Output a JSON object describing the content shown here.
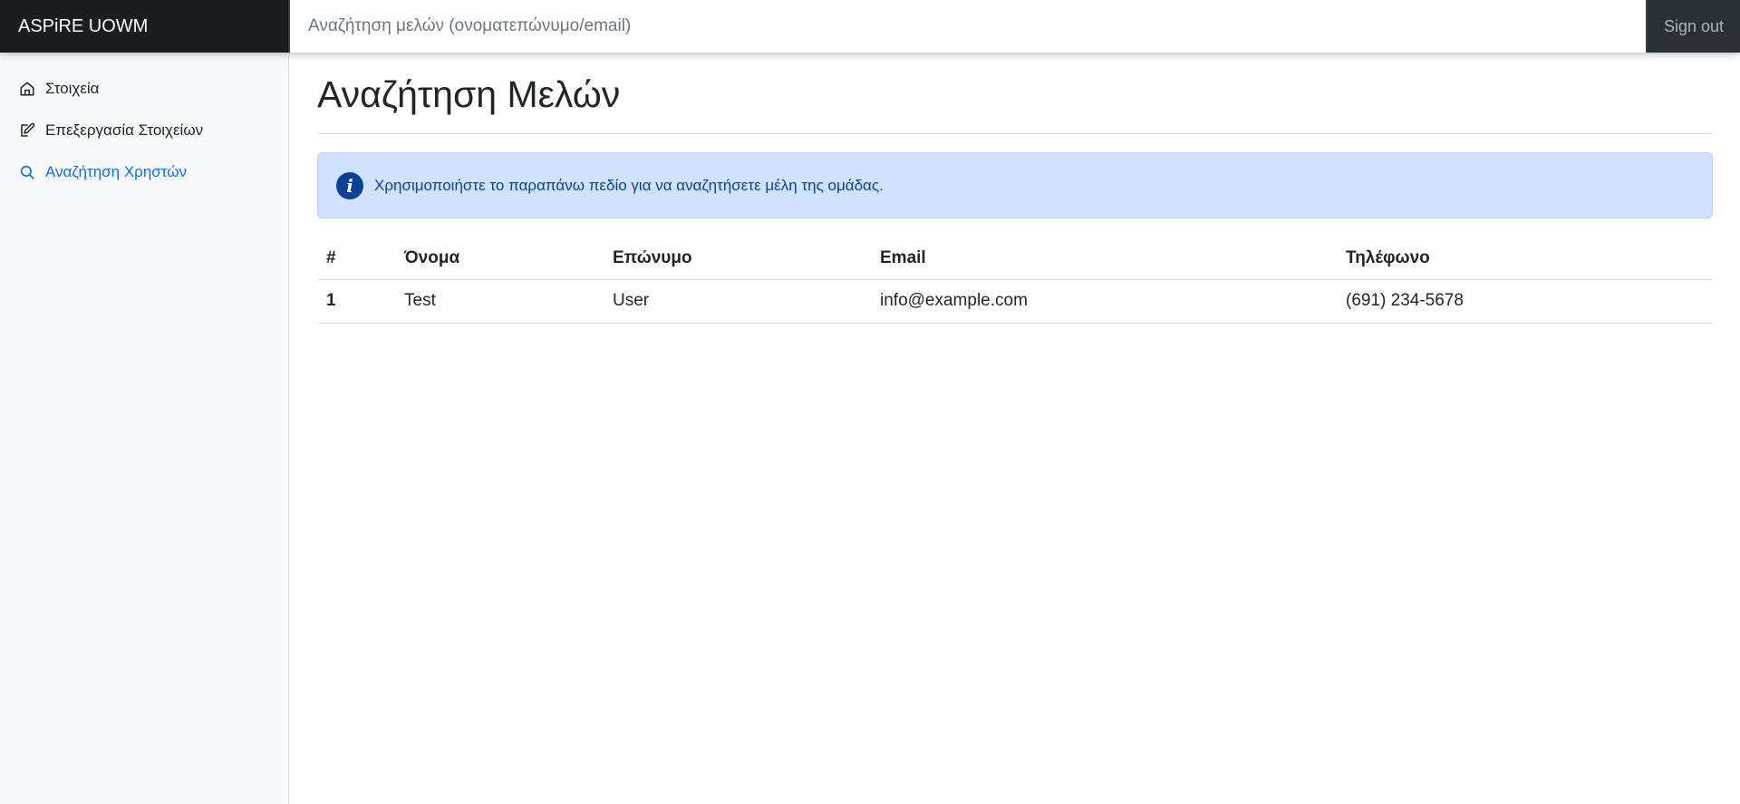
{
  "header": {
    "brand": "ASPiRE UOWM",
    "search_placeholder": "Αναζήτηση μελών (ονοματεπώνυμο/email)",
    "search_value": "",
    "signout_label": "Sign out"
  },
  "sidebar": {
    "items": [
      {
        "label": "Στοιχεία",
        "icon": "home-icon",
        "active": false
      },
      {
        "label": "Επεξεργασία Στοιχείων",
        "icon": "edit-icon",
        "active": false
      },
      {
        "label": "Αναζήτηση Χρηστών",
        "icon": "search-icon",
        "active": true
      }
    ]
  },
  "main": {
    "title": "Αναζήτηση Μελών",
    "alert": {
      "icon": "info-icon",
      "icon_glyph": "i",
      "text": "Χρησιμοποιήστε το παραπάνω πεδίο για να αναζητήσετε μέλη της ομάδας."
    },
    "table": {
      "headers": [
        "#",
        "Όνομα",
        "Επώνυμο",
        "Email",
        "Τηλέφωνο"
      ],
      "rows": [
        [
          "1",
          "Test",
          "User",
          "info@example.com",
          "(691) 234-5678"
        ]
      ]
    }
  },
  "colors": {
    "topbar": "#212529",
    "sidebar": "#f8f9fa",
    "active_link": "#0d6efd",
    "alert_bg": "#cfe2ff",
    "alert_text": "#084298"
  }
}
